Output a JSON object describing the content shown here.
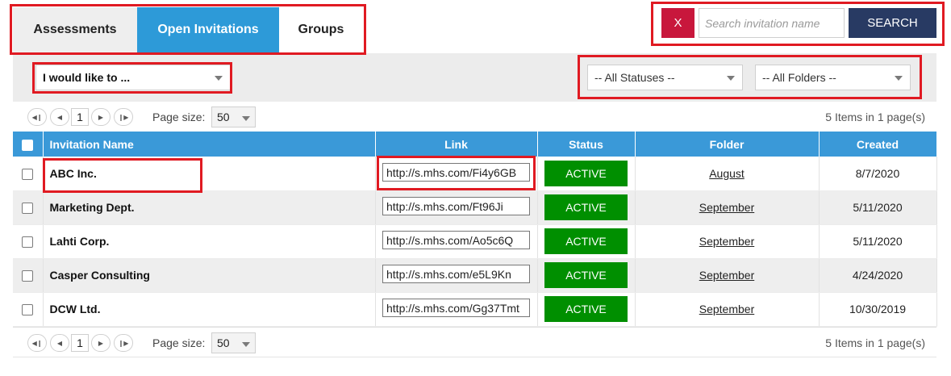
{
  "tabs": [
    {
      "label": "Assessments",
      "active": false
    },
    {
      "label": "Open Invitations",
      "active": true
    },
    {
      "label": "Groups",
      "active": false
    }
  ],
  "search": {
    "clear_label": "X",
    "placeholder": "Search invitation name",
    "button_label": "SEARCH"
  },
  "filters": {
    "action": "I would like to ...",
    "status": "-- All Statuses --",
    "folder": "-- All Folders --"
  },
  "pager": {
    "first_icon": "first-page-icon",
    "prev_icon": "prev-page-icon",
    "page": "1",
    "next_icon": "next-page-icon",
    "last_icon": "last-page-icon",
    "page_size_label": "Page size:",
    "page_size": "50",
    "info": "5 Items in 1 page(s)"
  },
  "table": {
    "columns": [
      "Invitation Name",
      "Link",
      "Status",
      "Folder",
      "Created"
    ],
    "rows": [
      {
        "name": "ABC Inc.",
        "link": "http://s.mhs.com/Fi4y6GB",
        "status": "ACTIVE",
        "folder": "August",
        "created": "8/7/2020"
      },
      {
        "name": "Marketing Dept.",
        "link": "http://s.mhs.com/Ft96Ji",
        "status": "ACTIVE",
        "folder": "September",
        "created": "5/11/2020"
      },
      {
        "name": "Lahti Corp.",
        "link": "http://s.mhs.com/Ao5c6Q",
        "status": "ACTIVE",
        "folder": "September",
        "created": "5/11/2020"
      },
      {
        "name": "Casper Consulting",
        "link": "http://s.mhs.com/e5L9Kn",
        "status": "ACTIVE",
        "folder": "September",
        "created": "4/24/2020"
      },
      {
        "name": "DCW Ltd.",
        "link": "http://s.mhs.com/Gg37Tmt",
        "status": "ACTIVE",
        "folder": "September",
        "created": "10/30/2019"
      }
    ]
  },
  "colors": {
    "tab_active": "#2d9ad8",
    "header": "#3a99d8",
    "clear_button": "#c8173c",
    "search_button": "#283a63",
    "status_active": "#008f00",
    "highlight": "#e01a22"
  }
}
